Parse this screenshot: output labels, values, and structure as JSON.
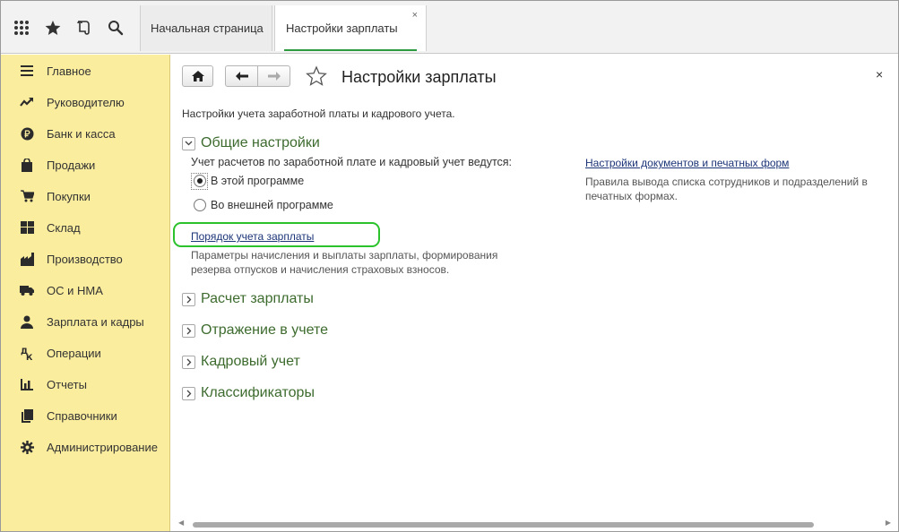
{
  "topbar": {
    "icons": [
      "apps-grid-icon",
      "star-icon",
      "history-icon",
      "search-icon"
    ],
    "tabs": [
      {
        "label": "Начальная страница"
      },
      {
        "label": "Настройки зарплаты",
        "close": "×"
      }
    ]
  },
  "sidebar": {
    "background": "#fbed9e",
    "items": [
      {
        "label": "Главное",
        "icon": "menu-icon"
      },
      {
        "label": "Руководителю",
        "icon": "trend-icon"
      },
      {
        "label": "Банк и касса",
        "icon": "ruble-icon"
      },
      {
        "label": "Продажи",
        "icon": "bag-icon"
      },
      {
        "label": "Покупки",
        "icon": "cart-icon"
      },
      {
        "label": "Склад",
        "icon": "warehouse-icon"
      },
      {
        "label": "Производство",
        "icon": "factory-icon"
      },
      {
        "label": "ОС и НМА",
        "icon": "truck-icon"
      },
      {
        "label": "Зарплата и кадры",
        "icon": "person-icon"
      },
      {
        "label": "Операции",
        "icon": "operations-icon"
      },
      {
        "label": "Отчеты",
        "icon": "bar-chart-icon"
      },
      {
        "label": "Справочники",
        "icon": "books-icon"
      },
      {
        "label": "Администрирование",
        "icon": "gear-icon"
      }
    ]
  },
  "form": {
    "title": "Настройки зарплаты",
    "close": "×",
    "description": "Настройки учета заработной платы и кадрового учета.",
    "general": {
      "title": "Общие настройки",
      "subtitle": "Учет расчетов по заработной плате и кадровый учет ведутся:",
      "options": [
        {
          "label": "В этой программе",
          "selected": true
        },
        {
          "label": "Во внешней программе",
          "selected": false
        }
      ],
      "payroll_link": "Порядок учета зарплаты",
      "payroll_hint_1": "Параметры начисления и выплаты зарплаты, формирования",
      "payroll_hint_2": "резерва отпусков и начисления страховых взносов.",
      "docs_link": "Настройки документов и печатных форм",
      "docs_hint_1": "Правила вывода списка сотрудников и подразделений в",
      "docs_hint_2": "печатных формах."
    },
    "sections": [
      {
        "title": "Расчет зарплаты"
      },
      {
        "title": "Отражение в учете"
      },
      {
        "title": "Кадровый учет"
      },
      {
        "title": "Классификаторы"
      }
    ],
    "accent_color": "#2bc22b",
    "group_title_color": "#3d6b2e",
    "link_color": "#1c3578"
  }
}
